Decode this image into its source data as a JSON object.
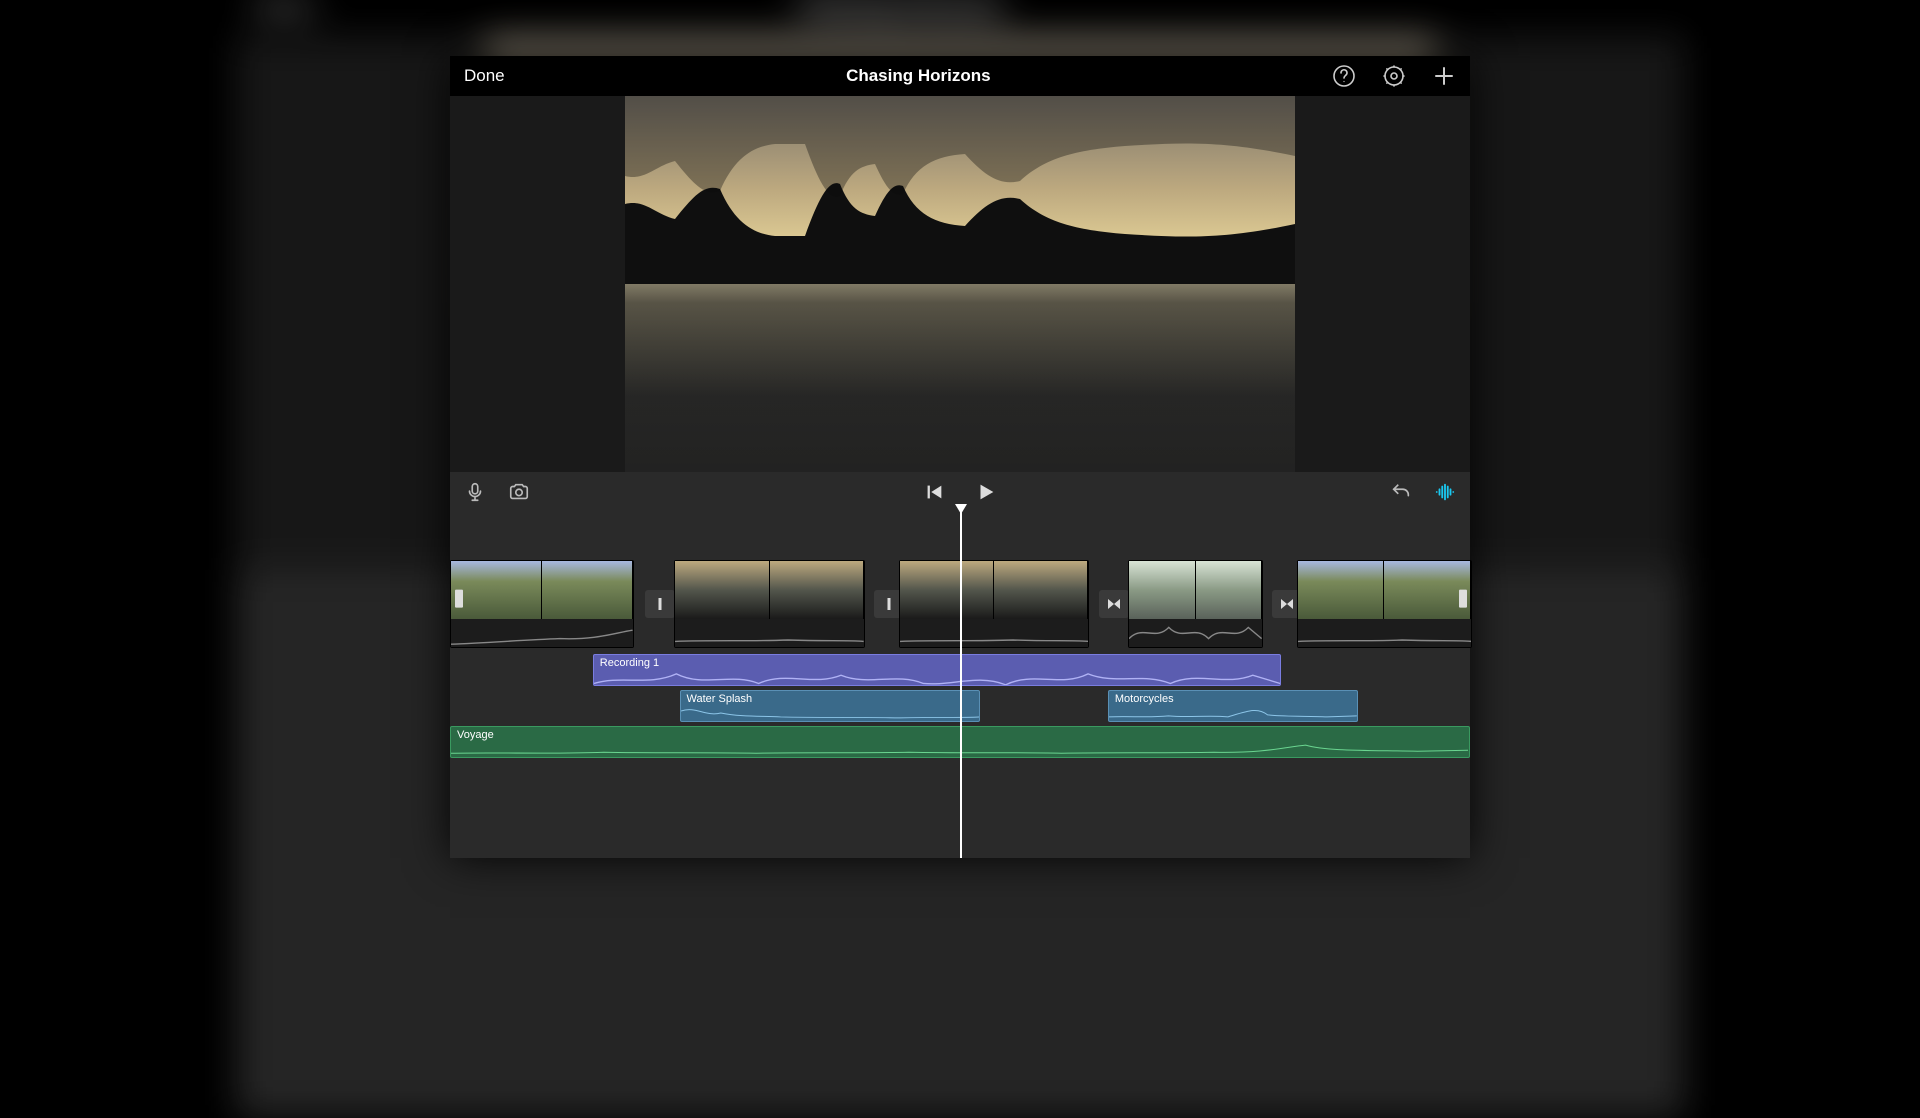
{
  "background_title": "Chasing Horizons",
  "nav": {
    "done_label": "Done",
    "title": "Chasing Horizons",
    "icons": [
      "help",
      "settings",
      "add"
    ]
  },
  "transport": {
    "left_icons": [
      "microphone",
      "camera"
    ],
    "center_icons": [
      "skip-back",
      "play"
    ],
    "right_icons": [
      "undo",
      "waveform"
    ]
  },
  "timeline": {
    "playhead_pct": 50.0,
    "video_clips": [
      {
        "id": "clip1",
        "style": "peaks",
        "left_pct": 0,
        "width_pct": 17.8,
        "handle": "left",
        "transition_after": "bar"
      },
      {
        "id": "clip2",
        "style": "lake",
        "left_pct": 22,
        "width_pct": 18.5,
        "transition_after": "bar"
      },
      {
        "id": "clip3",
        "style": "lake",
        "left_pct": 44,
        "width_pct": 18.5,
        "transition_after": "cross"
      },
      {
        "id": "clip4",
        "style": "road",
        "left_pct": 66.5,
        "width_pct": 13,
        "transition_after": "cross"
      },
      {
        "id": "clip5",
        "style": "peaks",
        "left_pct": 83,
        "width_pct": 17,
        "handle": "right"
      }
    ],
    "audio": {
      "track1": {
        "label": "Recording 1",
        "color": "purple",
        "left_pct": 14,
        "width_pct": 67.5
      },
      "track2a": {
        "label": "Water Splash",
        "color": "blue",
        "left_pct": 22.5,
        "width_pct": 29.5
      },
      "track2b": {
        "label": "Motorcycles",
        "color": "blue",
        "left_pct": 64.5,
        "width_pct": 24.5
      },
      "track3": {
        "label": "Voyage",
        "color": "green",
        "left_pct": 0,
        "width_pct": 100
      }
    }
  }
}
